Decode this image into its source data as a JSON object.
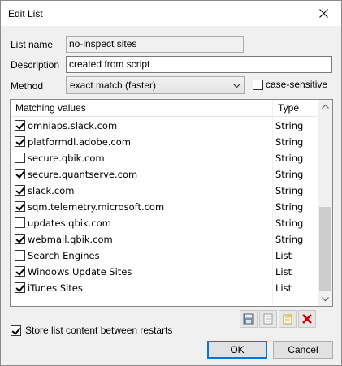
{
  "window": {
    "title": "Edit List"
  },
  "form": {
    "list_name_label": "List name",
    "list_name_value": "no-inspect sites",
    "description_label": "Description",
    "description_value": "created from script",
    "method_label": "Method",
    "method_value": "exact match (faster)",
    "case_sensitive_label": "case-sensitive",
    "case_sensitive_checked": false
  },
  "table": {
    "columns": [
      "Matching values",
      "Type"
    ],
    "rows": [
      {
        "value": "omniaps.slack.com",
        "type": "String",
        "checked": true
      },
      {
        "value": "platformdl.adobe.com",
        "type": "String",
        "checked": true
      },
      {
        "value": "secure.qbik.com",
        "type": "String",
        "checked": false
      },
      {
        "value": "secure.quantserve.com",
        "type": "String",
        "checked": true
      },
      {
        "value": "slack.com",
        "type": "String",
        "checked": true
      },
      {
        "value": "sqm.telemetry.microsoft.com",
        "type": "String",
        "checked": true
      },
      {
        "value": "updates.qbik.com",
        "type": "String",
        "checked": false
      },
      {
        "value": "webmail.qbik.com",
        "type": "String",
        "checked": true
      },
      {
        "value": "Search Engines",
        "type": "List",
        "checked": false
      },
      {
        "value": "Windows Update Sites",
        "type": "List",
        "checked": true
      },
      {
        "value": "iTunes Sites",
        "type": "List",
        "checked": true
      }
    ]
  },
  "toolbar": {
    "icons": [
      "save-icon",
      "list-icon",
      "edit-list-icon",
      "delete-icon"
    ],
    "delete_color": "#d00000"
  },
  "footer": {
    "store_label": "Store list content between restarts",
    "store_checked": true,
    "ok_label": "OK",
    "cancel_label": "Cancel"
  }
}
